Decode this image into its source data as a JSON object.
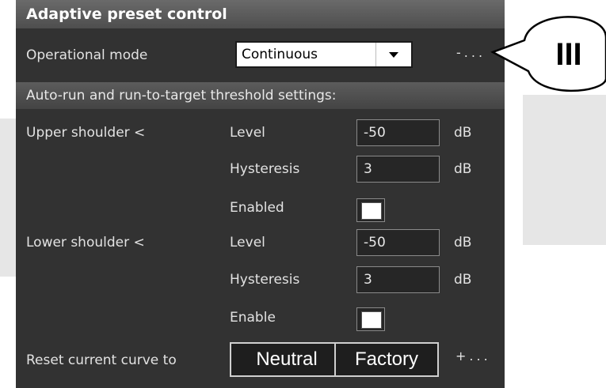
{
  "panel": {
    "title": "Adaptive preset control",
    "operational_mode": {
      "label": "Operational mode",
      "selected": "Continuous",
      "more": "-..."
    },
    "section_title": "Auto-run and run-to-target threshold settings:",
    "upper_shoulder": {
      "label": "Upper shoulder <",
      "level_label": "Level",
      "level_value": "-50",
      "level_unit": "dB",
      "hysteresis_label": "Hysteresis",
      "hysteresis_value": "3",
      "hysteresis_unit": "dB",
      "enabled_label": "Enabled"
    },
    "lower_shoulder": {
      "label": "Lower shoulder <",
      "level_label": "Level",
      "level_value": "-50",
      "level_unit": "dB",
      "hysteresis_label": "Hysteresis",
      "hysteresis_value": "3",
      "hysteresis_unit": "dB",
      "enabled_label": "Enable"
    },
    "reset": {
      "label": "Reset current curve to",
      "neutral_label": "Neutral",
      "factory_label": "Factory",
      "more": "+..."
    }
  },
  "callout": {
    "text": "III"
  },
  "colors": {
    "panel_bg": "#323232",
    "header_bg": "#5c5c5c",
    "text": "#e2e2e2"
  }
}
